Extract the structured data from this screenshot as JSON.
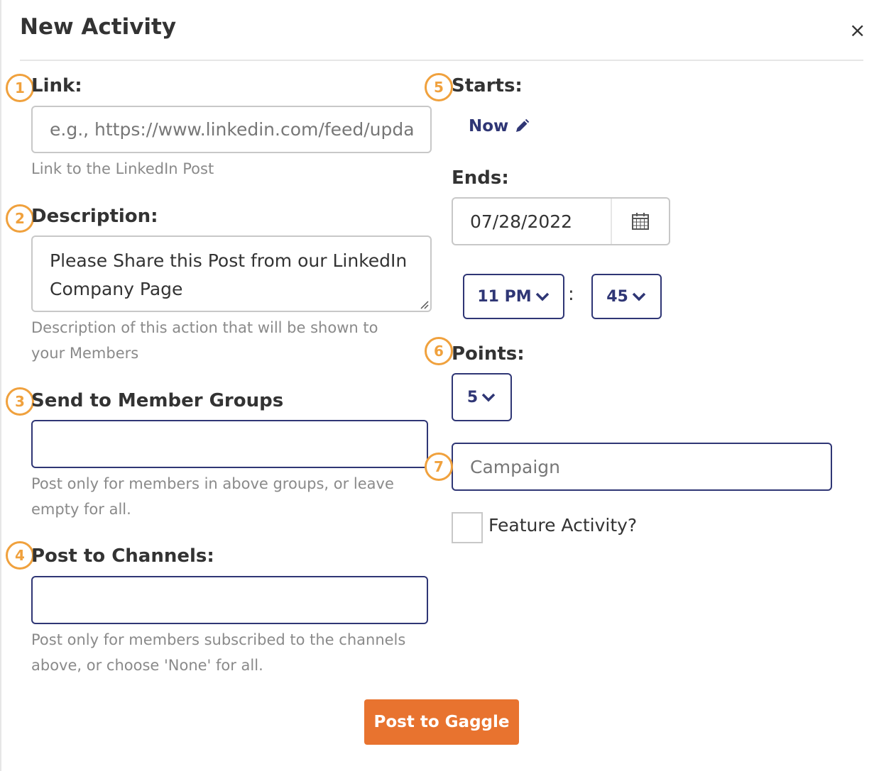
{
  "modal": {
    "title": "New Activity",
    "close_label": "×"
  },
  "link": {
    "badge": "1",
    "label": "Link:",
    "placeholder": "e.g., https://www.linkedin.com/feed/update/...",
    "help": "Link to the LinkedIn Post"
  },
  "description": {
    "badge": "2",
    "label": "Description:",
    "value": "Please Share this Post from our LinkedIn Company Page",
    "help_line1": "Description of this action that will be shown to",
    "help_line2": "your Members"
  },
  "member_groups": {
    "badge": "3",
    "label": "Send to Member Groups",
    "help_line1": "Post only for members in above groups, or leave",
    "help_line2": "empty for all."
  },
  "channels": {
    "badge": "4",
    "label": "Post to Channels:",
    "help_line1": "Post only for members subscribed to the channels",
    "help_line2": "above, or choose 'None' for all."
  },
  "starts": {
    "badge": "5",
    "label": "Starts:",
    "value": "Now"
  },
  "ends": {
    "label": "Ends:",
    "date": "07/28/2022",
    "hour": "11 PM",
    "separator": ":",
    "minute": "45"
  },
  "points": {
    "badge": "6",
    "label": "Points:",
    "value": "5"
  },
  "campaign": {
    "badge": "7",
    "placeholder": "Campaign"
  },
  "feature": {
    "label": "Feature Activity?",
    "checked": false
  },
  "submit_label": "Post to Gaggle",
  "colors": {
    "accent_orange": "#e8732f",
    "badge_orange": "#f0a13d",
    "navy": "#2f3675",
    "help_gray": "#8a8a8a"
  }
}
